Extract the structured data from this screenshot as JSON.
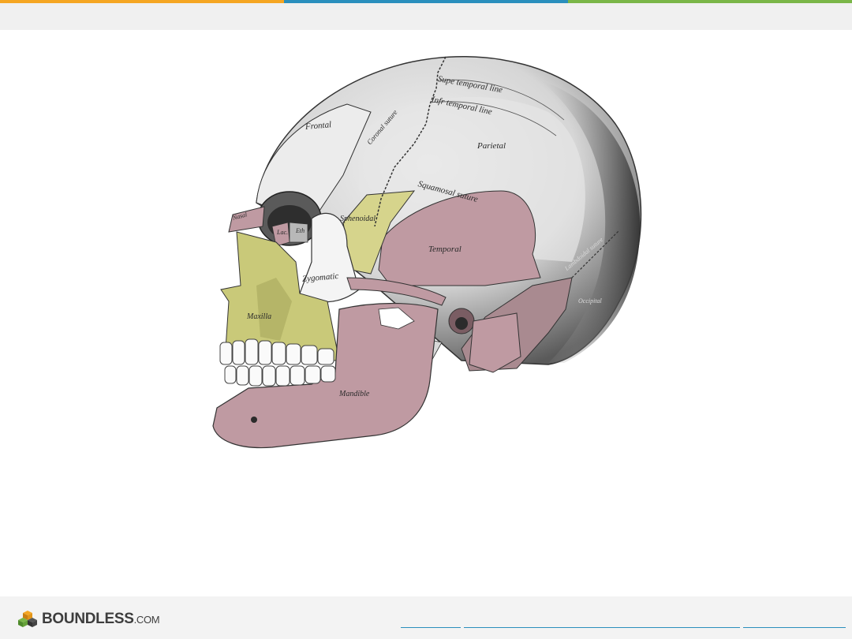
{
  "colors": {
    "stripe": [
      "#f5a623",
      "#2a8fbd",
      "#7ab648"
    ],
    "bone_gray": "#c9c9c9",
    "bone_yellow": "#c9c979",
    "bone_pink": "#bf9aa2"
  },
  "figure": {
    "labels": {
      "supe_temporal_line": "Supe temporal line",
      "infr_temporal_line": "Infr temporal line",
      "coronal_suture": "Coronal suture",
      "frontal": "Frontal",
      "parietal": "Parietal",
      "squamosal_suture": "Squamosal suture",
      "nasal": "Nasal",
      "lac": "Lac.",
      "eth": "Eth",
      "sphenoidal": "Sphenoidal",
      "temporal": "Temporal",
      "zygomatic": "Zygomatic",
      "maxilla": "Maxilla",
      "mandible": "Mandible",
      "lambdoidal_suture": "Lambdoidal suture",
      "occipital": "Occipital"
    }
  },
  "footer": {
    "brand": "BOUNDLESS",
    "brand_suffix": ".COM",
    "logo_icon": "stacked-cubes-icon"
  }
}
